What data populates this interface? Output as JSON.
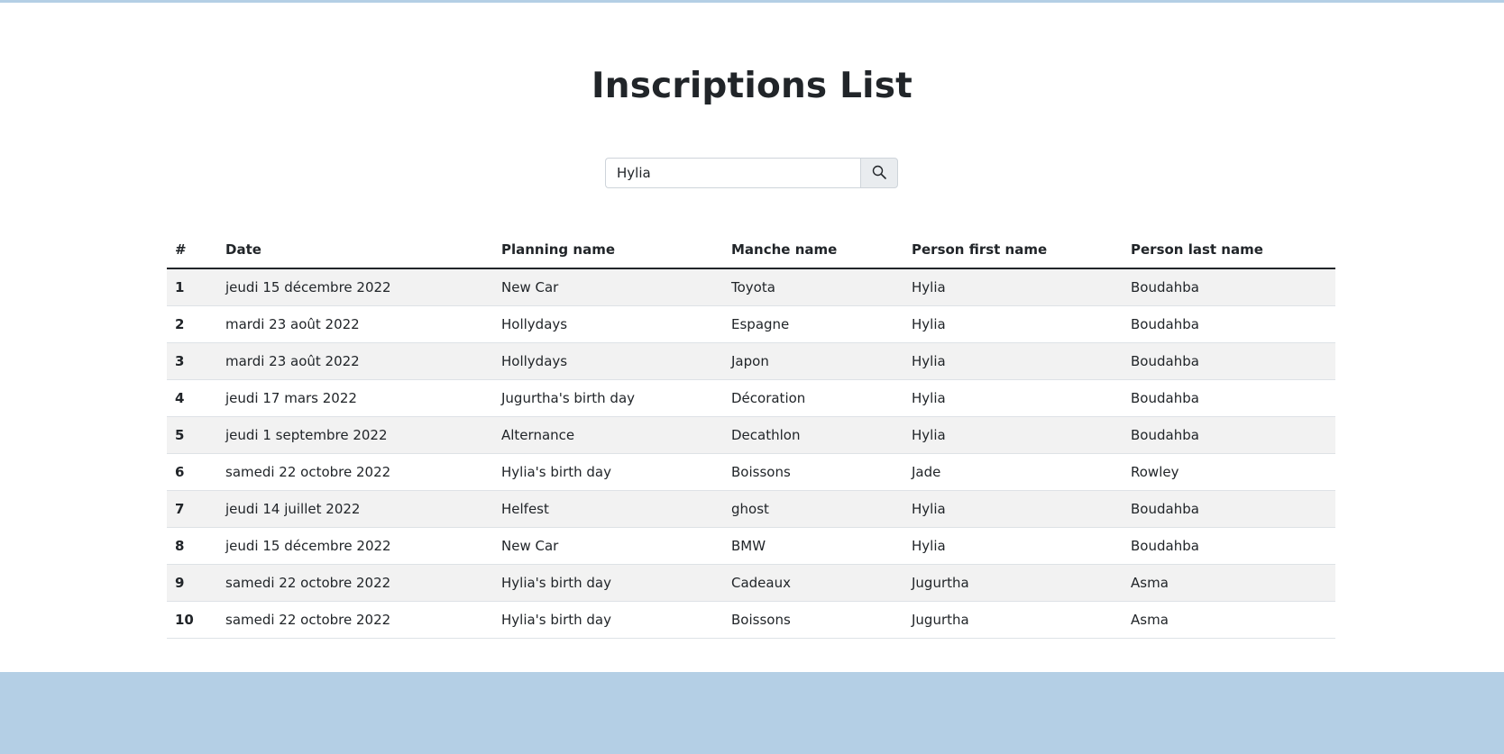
{
  "page": {
    "title": "Inscriptions List"
  },
  "search": {
    "value": "Hylia",
    "button_icon": "search-icon"
  },
  "colors": {
    "band": "#b4cfe5",
    "stripe": "#f2f2f2",
    "header_rule": "#212529"
  },
  "table": {
    "headers": [
      "#",
      "Date",
      "Planning name",
      "Manche name",
      "Person first name",
      "Person last name"
    ],
    "rows": [
      [
        "1",
        "jeudi 15 décembre 2022",
        "New Car",
        "Toyota",
        "Hylia",
        "Boudahba"
      ],
      [
        "2",
        "mardi 23 août 2022",
        "Hollydays",
        "Espagne",
        "Hylia",
        "Boudahba"
      ],
      [
        "3",
        "mardi 23 août 2022",
        "Hollydays",
        "Japon",
        "Hylia",
        "Boudahba"
      ],
      [
        "4",
        "jeudi 17 mars 2022",
        "Jugurtha's birth day",
        "Décoration",
        "Hylia",
        "Boudahba"
      ],
      [
        "5",
        "jeudi 1 septembre 2022",
        "Alternance",
        "Decathlon",
        "Hylia",
        "Boudahba"
      ],
      [
        "6",
        "samedi 22 octobre 2022",
        "Hylia's birth day",
        "Boissons",
        "Jade",
        "Rowley"
      ],
      [
        "7",
        "jeudi 14 juillet 2022",
        "Helfest",
        "ghost",
        "Hylia",
        "Boudahba"
      ],
      [
        "8",
        "jeudi 15 décembre 2022",
        "New Car",
        "BMW",
        "Hylia",
        "Boudahba"
      ],
      [
        "9",
        "samedi 22 octobre 2022",
        "Hylia's birth day",
        "Cadeaux",
        "Jugurtha",
        "Asma"
      ],
      [
        "10",
        "samedi 22 octobre 2022",
        "Hylia's birth day",
        "Boissons",
        "Jugurtha",
        "Asma"
      ]
    ]
  }
}
